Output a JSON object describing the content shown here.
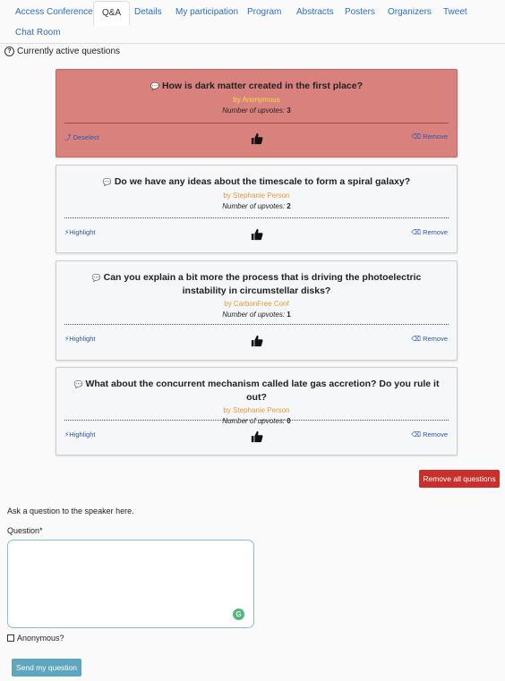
{
  "tabs": {
    "access": "Access Conference",
    "qa": "Q&A",
    "details": "Details",
    "my_participation": "My participation",
    "program": "Program",
    "abstracts": "Abstracts",
    "posters": "Posters",
    "organizers": "Organizers",
    "tweet": "Tweet",
    "chat_room": "Chat Room",
    "active": "Q&A"
  },
  "section_title": "Currently active questions",
  "questions": [
    {
      "text": "How is dark matter created in the first place?",
      "author": "by Anonymous",
      "upvotes_label": "Number of upvotes:",
      "upvotes": "3",
      "left_action": "Deselect",
      "right_action": "Remove",
      "selected": true
    },
    {
      "text": "Do we have any ideas about the timescale to form a spiral galaxy?",
      "author": "by Stephanie Person",
      "upvotes_label": "Number of upvotes:",
      "upvotes": "2",
      "left_action": "Highlight",
      "right_action": "Remove",
      "selected": false
    },
    {
      "text": "Can you explain a bit more the process that is driving the photoelectric instability in circumstellar disks?",
      "author": "by CarbonFree Conf",
      "upvotes_label": "Number of upvotes:",
      "upvotes": "1",
      "left_action": "Highlight",
      "right_action": "Remove",
      "selected": false
    },
    {
      "text": "What about the concurrent mechanism called late gas accretion? Do you rule it out?",
      "author": "by Stephanie Person",
      "upvotes_label": "Number of upvotes:",
      "upvotes": "0",
      "left_action": "Highlight",
      "right_action": "Remove",
      "selected": false
    }
  ],
  "remove_all_label": "Remove all questions",
  "form": {
    "ask_label": "Ask a question to the speaker here.",
    "question_label": "Question*",
    "question_value": "",
    "anonymous_label": "Anonymous?",
    "anonymous_checked": false,
    "send_label": "Send my question"
  },
  "colors": {
    "selected_card": "#d9827d",
    "link": "#2b56b0",
    "author": "#e59a3a",
    "danger_button": "#c9302c",
    "send_button": "#5ea6bd"
  }
}
